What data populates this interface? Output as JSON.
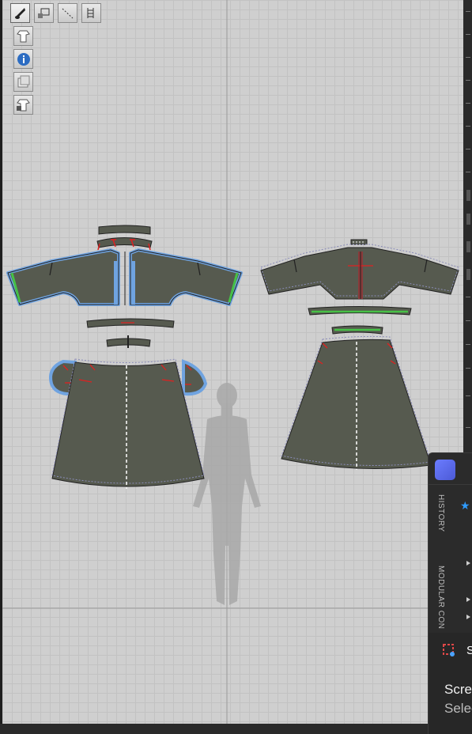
{
  "toolbar": {
    "row1": [
      "edit-pattern-icon",
      "transform-pattern-icon",
      "edit-curvature-icon",
      "sewing-icon"
    ],
    "column": [
      "show-avatar-icon",
      "show-garment-icon",
      "info-icon",
      "texture-icon",
      "lock-garment-icon"
    ]
  },
  "colors": {
    "canvas": "#cfcfcf",
    "pattern_fill": "#565a4f",
    "selection": "#6fa3e0",
    "sewing_red": "#e02020",
    "sewing_green": "#46c046",
    "accent": "#2f9bff"
  },
  "side_panel": {
    "tabs": [
      "HISTORY",
      "MODULAR CON"
    ]
  },
  "notification": {
    "app_initial": "S",
    "title": "Scre",
    "subtitle": "Selec"
  }
}
